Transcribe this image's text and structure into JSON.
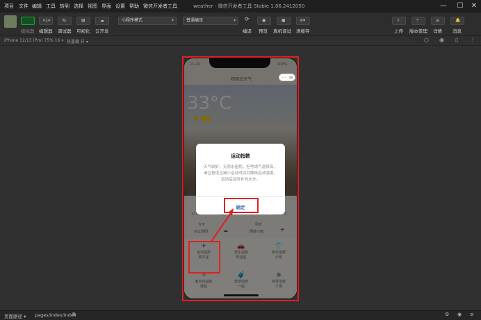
{
  "menu": [
    "项目",
    "文件",
    "编辑",
    "工具",
    "转到",
    "选择",
    "视图",
    "界面",
    "设置",
    "帮助",
    "微信开发者工具"
  ],
  "window_title": "weather - 微信开发者工具 Stable 1.06.2412050",
  "toolbar": {
    "simulator_label": "模拟器",
    "editor_label": "编辑器",
    "debugger_label": "调试器",
    "visual_label": "可视化",
    "cloud_label": "云开发",
    "mode_select": "小程序模式",
    "compile_select": "普通编译",
    "compile_label": "编译",
    "preview_label": "预览",
    "device_debug_label": "真机调试",
    "clear_cache_label": "清缓存",
    "upload_label": "上传",
    "version_label": "版本管理",
    "details_label": "详情",
    "messages_label": "消息"
  },
  "devicebar": {
    "device": "iPhone 12/13 (Pro) 75% 16 ▾",
    "hotreload": "热重载 开 ▾"
  },
  "phone": {
    "time": "11:24",
    "battery": "100%",
    "nav_title": "晴朗云天气",
    "temperature": "33°C",
    "forecast_temps": [
      "32°C",
      "30/25°C",
      "29°C",
      "30/25°C"
    ],
    "forecast_days": [
      "今天",
      "明天"
    ],
    "forecast_conditions": [
      "多云转阴",
      "阴转小雨"
    ],
    "tips": [
      {
        "icon": "✈",
        "title": "运动指数",
        "value": "较不宜"
      },
      {
        "icon": "🚗",
        "title": "洗车指数",
        "value": "较适宜"
      },
      {
        "icon": "👕",
        "title": "穿衣指数",
        "value": "炎热"
      },
      {
        "icon": "☼",
        "title": "紫外线指数",
        "value": "很强"
      },
      {
        "icon": "🧳",
        "title": "旅游指数",
        "value": "一般"
      },
      {
        "icon": "❄",
        "title": "感冒指数",
        "value": "少发"
      }
    ]
  },
  "modal": {
    "title": "运动指数",
    "text": "天气较好，无雨水困扰，但考虑气温很高，请注意适当减少运动时间并降低运动强度，运动后及时补充水分。",
    "ok": "确定"
  },
  "bottombar": {
    "path_label": "页面路径 ▾",
    "path": "pages/index/index"
  },
  "colors": {
    "accent_green": "#1aad19",
    "annotation_red": "#e02020",
    "modal_button_blue": "#3a6ec0"
  }
}
